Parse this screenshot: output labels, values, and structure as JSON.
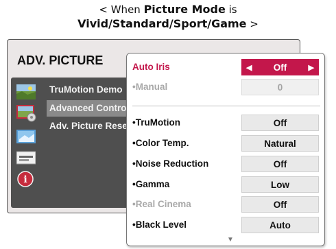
{
  "caption": {
    "line1_prefix": "< When ",
    "line1_bold": "Picture Mode",
    "line1_suffix": " is",
    "line2_bold": "Vivid/Standard/Sport/Game",
    "line2_suffix": " >"
  },
  "back_menu": {
    "title": "ADV. PICTURE",
    "items": [
      {
        "label": "TruMotion Demo",
        "selected": false
      },
      {
        "label": "Advanced Control",
        "selected": true
      },
      {
        "label": "Adv. Picture Reset",
        "selected": false
      }
    ],
    "icons": [
      "picture-icon",
      "picture-settings-icon",
      "screen-icon",
      "ticket-icon",
      "info-icon"
    ]
  },
  "front_menu": {
    "rows": [
      {
        "label": "Auto Iris",
        "value": "Off",
        "state": "active"
      },
      {
        "label": "•Manual",
        "value": "0",
        "state": "disabled"
      },
      {
        "label": "•TruMotion",
        "value": "Off",
        "state": "normal"
      },
      {
        "label": "•Color Temp.",
        "value": "Natural",
        "state": "normal"
      },
      {
        "label": "•Noise Reduction",
        "value": "Off",
        "state": "normal"
      },
      {
        "label": "•Gamma",
        "value": "Low",
        "state": "normal"
      },
      {
        "label": "•Real Cinema",
        "value": "Off",
        "state": "label-disabled"
      },
      {
        "label": "•Black Level",
        "value": "Auto",
        "state": "normal"
      }
    ],
    "arrow_left": "◀",
    "arrow_right": "▶",
    "scroll_indicator": "▼"
  },
  "colors": {
    "accent": "#c3174b",
    "back_list": "#4f4f4f",
    "value_bg": "#e9e9e9"
  }
}
